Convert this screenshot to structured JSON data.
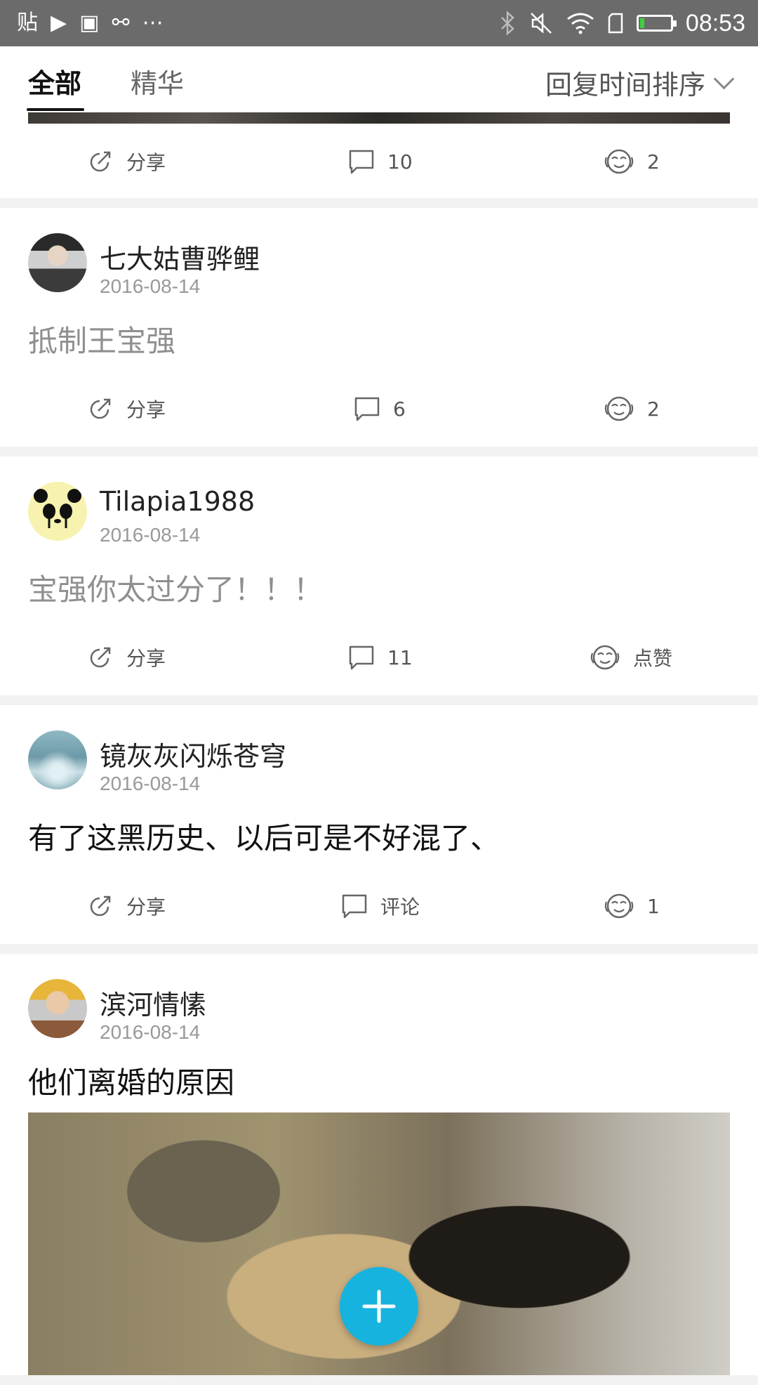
{
  "status_bar": {
    "left_glyphs": [
      "贴",
      "▶",
      "▣",
      "⚯",
      "⋯"
    ],
    "time": "08:53"
  },
  "tabs": {
    "all": "全部",
    "featured": "精华",
    "sort_label": "回复时间排序"
  },
  "posts": [
    {
      "partial": true,
      "share": "分享",
      "comments": "10",
      "likes": "2"
    },
    {
      "user": "七大姑曹骅鲤",
      "date": "2016-08-14",
      "text": "抵制王宝强",
      "share": "分享",
      "comments": "6",
      "likes": "2"
    },
    {
      "user": "Tilapia1988",
      "date": "2016-08-14",
      "text": "宝强你太过分了！！！",
      "share": "分享",
      "comments": "11",
      "likes": "点赞"
    },
    {
      "user": "镜灰灰闪烁苍穹",
      "date": "2016-08-14",
      "text": "有了这黑历史、以后可是不好混了、",
      "share": "分享",
      "comments": "评论",
      "likes": "1"
    },
    {
      "user": "滨河情愫",
      "date": "2016-08-14",
      "text": "他们离婚的原因"
    }
  ],
  "colors": {
    "accent": "#17b3df",
    "status_bar": "#6b6b6b",
    "gray_text": "#8f8f8f"
  }
}
